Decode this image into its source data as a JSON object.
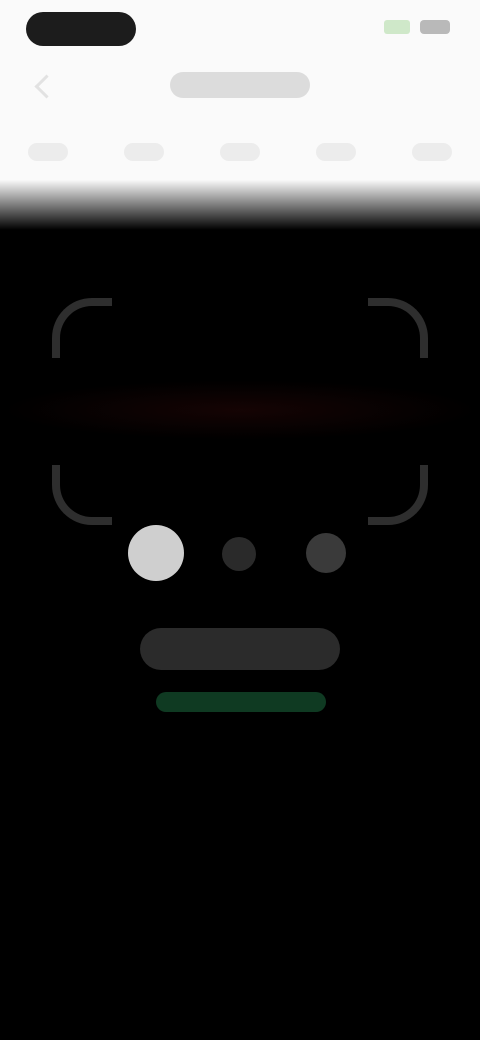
{
  "status_bar": {
    "time": "",
    "icons": [
      "signal-icon",
      "battery-icon"
    ]
  },
  "header": {
    "title": "",
    "back_icon": "back-chevron-icon",
    "toolbar_items": [
      "",
      "",
      "",
      "",
      ""
    ]
  },
  "scanner": {
    "frame_icon": "scan-frame-corners",
    "page_indicator": {
      "total": 3,
      "active_index": 0
    },
    "hint": "",
    "link": ""
  },
  "colors": {
    "header_background": "#fafafa",
    "scan_background": "#000000",
    "active_dot": "#cfcfcf",
    "link": "#0f3a22"
  }
}
